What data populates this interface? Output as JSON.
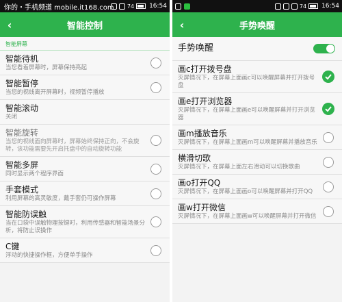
{
  "left": {
    "status": {
      "time": "16:54",
      "battery": "74",
      "watermark": "你的・手机频道 mobile.it168.com"
    },
    "title": "智能控制",
    "section": "智能屏幕",
    "items": [
      {
        "title": "智能待机",
        "desc": "当您看着屏幕时，屏幕保持亮起"
      },
      {
        "title": "智能暂停",
        "desc": "当您的视线离开屏幕时，视频暂停播放"
      },
      {
        "title": "智能滚动",
        "desc": "关闭"
      },
      {
        "title": "智能旋转",
        "desc": "当您的视线面向屏幕时，屏幕始终保持正向，不会旋转，该功能需要先开启托盘中的自动旋转功能"
      },
      {
        "title": "智能多屏",
        "desc": "同时显示两个程序界面"
      },
      {
        "title": "手套模式",
        "desc": "利用屏幕的高灵敏度，戴手套仍可操作屏幕"
      },
      {
        "title": "智能防误触",
        "desc": "当在口袋中误触物理按键时，利用传感器和智能场景分析，将防止误操作"
      },
      {
        "title": "C键",
        "desc": "浮动的快捷操作框，方便单手操作"
      }
    ]
  },
  "right": {
    "status": {
      "time": "16:54",
      "battery": "74"
    },
    "title": "手势唤醒",
    "master": {
      "title": "手势唤醒"
    },
    "items": [
      {
        "title": "画c打开拨号盘",
        "desc": "灭屏情况下，在屏幕上面画c可以唤醒屏幕并打开拨号盘",
        "checked": true
      },
      {
        "title": "画e打开浏览器",
        "desc": "灭屏情况下，在屏幕上面画e可以唤醒屏幕并打开浏览器",
        "checked": true
      },
      {
        "title": "画m播放音乐",
        "desc": "灭屏情况下，在屏幕上面画m可以唤醒屏幕并播放音乐",
        "checked": false
      },
      {
        "title": "横滑切歌",
        "desc": "灭屏情况下，在屏幕上面左右滑动可以切换歌曲",
        "checked": false
      },
      {
        "title": "画o打开QQ",
        "desc": "灭屏情况下，在屏幕上面画o可以唤醒屏幕并打开QQ",
        "checked": false
      },
      {
        "title": "画w打开微信",
        "desc": "灭屏情况下，在屏幕上面画w可以唤醒屏幕并打开微信",
        "checked": false
      }
    ]
  },
  "colors": {
    "accent": "#2eb24d",
    "statusbar": "#111111",
    "background": "#f3f3f3"
  }
}
